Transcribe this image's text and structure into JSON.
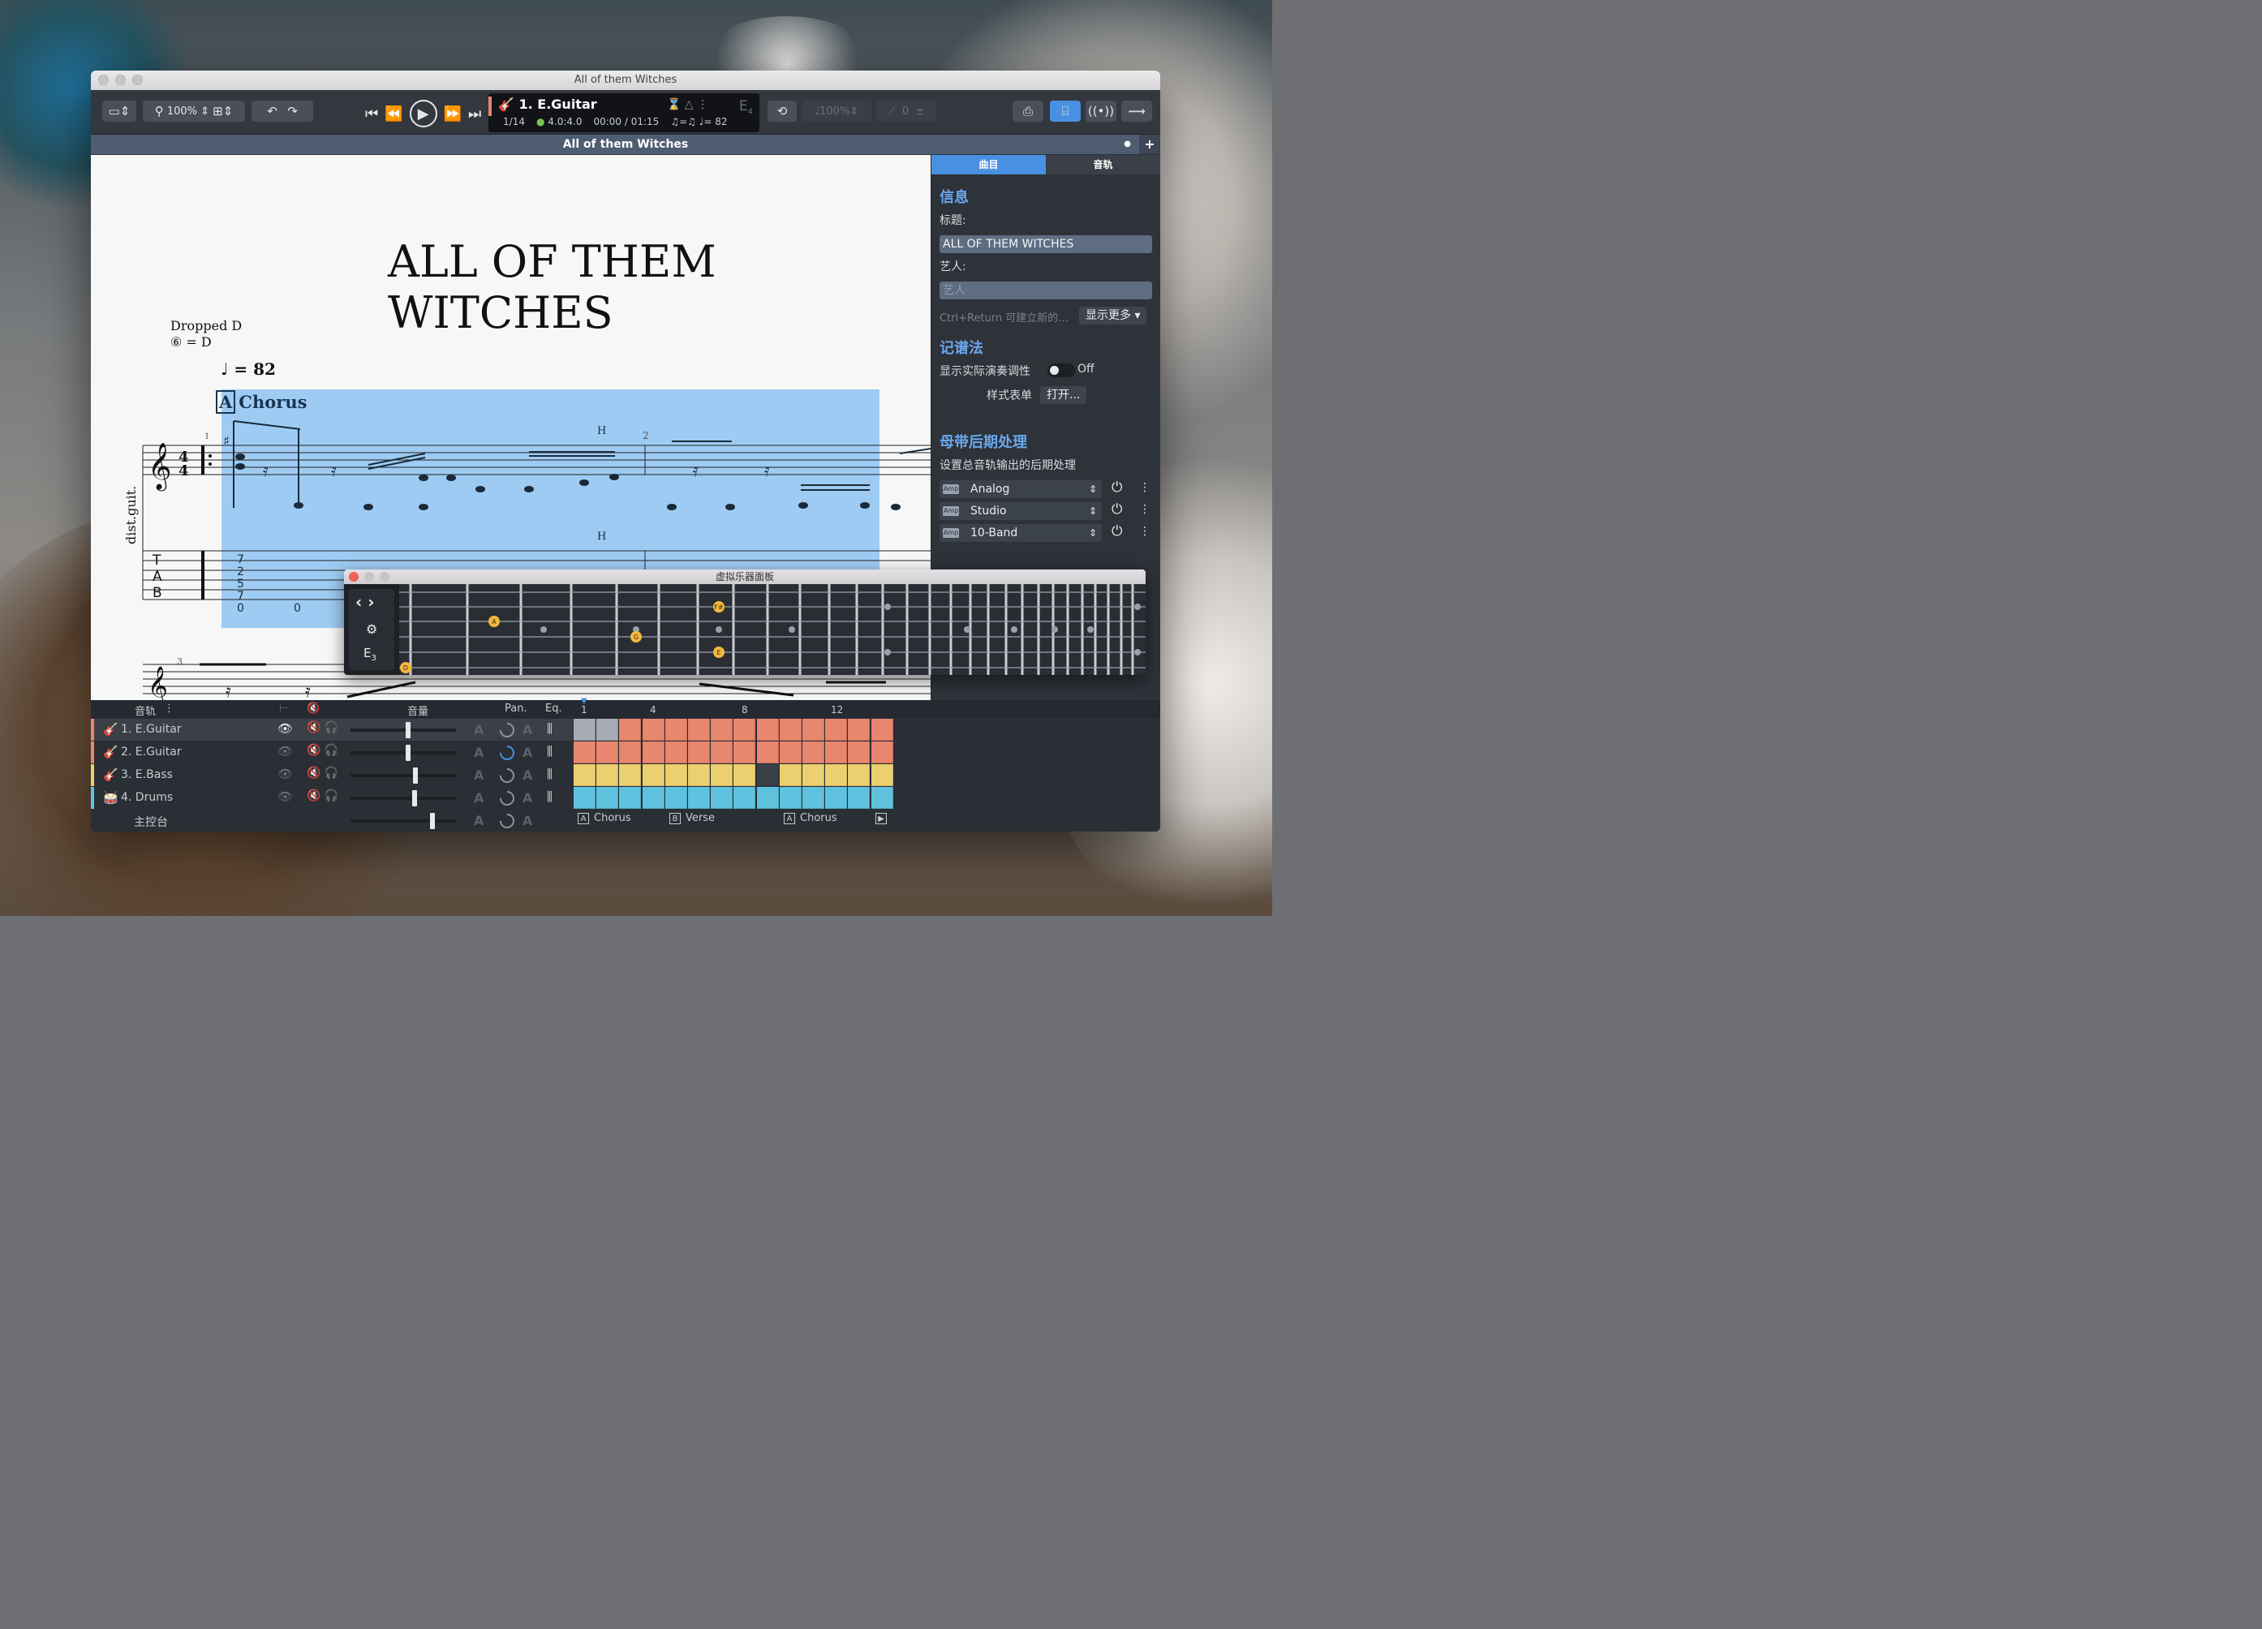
{
  "window": {
    "title": "All of them Witches"
  },
  "toolbar": {
    "zoom": "100%",
    "track_name": "1. E.Guitar",
    "bar_pos": "1/14",
    "sig": "4.0:4.0",
    "time": "00:00 / 01:15",
    "tempo": "= 82",
    "tuning_note": "E",
    "tuning_oct": "4",
    "speed": "100%",
    "pitch": "0"
  },
  "tab": {
    "title": "All of them Witches"
  },
  "score": {
    "title": "ALL OF THEM WITCHES",
    "tuning_line1": "Dropped D",
    "tuning_line2": "⑥ = D",
    "tempo": "= 82",
    "section_letter": "A",
    "section_name": "Chorus",
    "instrument": "dist.guit.",
    "bar1": "1",
    "bar2": "2",
    "bar3": "3",
    "hammer": "H",
    "tab_col1": [
      "7",
      "2",
      "5",
      "7",
      "0"
    ],
    "tab_zero": "0"
  },
  "sidebar": {
    "tab_song": "曲目",
    "tab_track": "音轨",
    "info_heading": "信息",
    "title_label": "标题:",
    "title_value": "ALL OF THEM WITCHES",
    "artist_label": "艺人:",
    "artist_placeholder": "艺人",
    "hint": "Ctrl+Return 可建立新的…",
    "show_more": "显示更多",
    "notation_heading": "记谱法",
    "transpose_label": "显示实际演奏调性",
    "transpose_state": "Off",
    "stylesheet_label": "样式表单",
    "open_button": "打开...",
    "master_heading": "母带后期处理",
    "master_desc": "设置总音轨输出的后期处理",
    "effects": [
      {
        "name": "Analog"
      },
      {
        "name": "Studio"
      },
      {
        "name": "10-Band"
      }
    ]
  },
  "fretboard": {
    "title": "虚拟乐器面板",
    "note": "E",
    "octave": "3",
    "dots": [
      "A",
      "F#",
      "G",
      "E",
      "D"
    ]
  },
  "tracks": {
    "header_tracks": "音轨",
    "header_volume": "音量",
    "header_pan": "Pan.",
    "header_eq": "Eq.",
    "bar_markers": [
      "1",
      "4",
      "8",
      "12"
    ],
    "items": [
      {
        "name": "1. E.Guitar",
        "color": "#e8866e"
      },
      {
        "name": "2. E.Guitar",
        "color": "#e8866e"
      },
      {
        "name": "3. E.Bass",
        "color": "#ecd070"
      },
      {
        "name": "4. Drums",
        "color": "#5fc3df"
      }
    ],
    "master": "主控台",
    "sections": [
      {
        "letter": "A",
        "name": "Chorus"
      },
      {
        "letter": "B",
        "name": "Verse"
      },
      {
        "letter": "A",
        "name": "Chorus"
      }
    ]
  },
  "colors": {
    "accent": "#4a90e2",
    "selection": "#9ecbf3",
    "guitar": "#e8866e",
    "bass": "#ecd070",
    "drums": "#5fc3df"
  }
}
